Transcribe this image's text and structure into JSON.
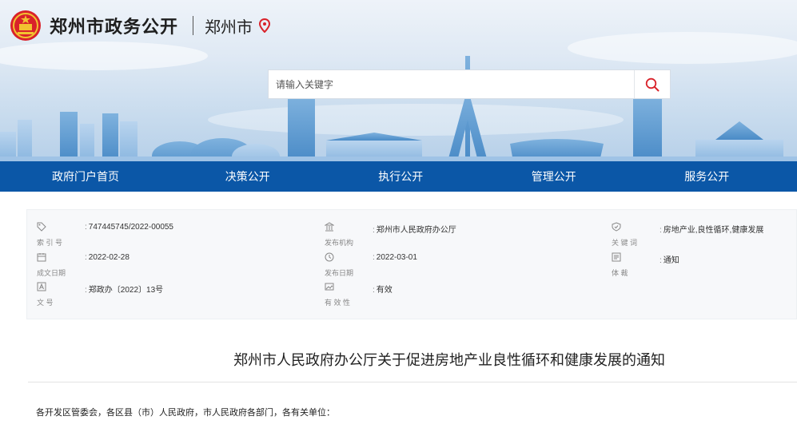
{
  "header": {
    "site_title": "郑州市政务公开",
    "city_name": "郑州市"
  },
  "search": {
    "placeholder": "请输入关键字"
  },
  "nav": {
    "items": [
      "政府门户首页",
      "决策公开",
      "执行公开",
      "管理公开",
      "服务公开"
    ]
  },
  "info": {
    "index_no": {
      "label": "索 引 号",
      "value": "747445745/2022-00055"
    },
    "publisher": {
      "label": "发布机构",
      "value": "郑州市人民政府办公厅"
    },
    "keywords": {
      "label": "关 键 词",
      "value": "房地产业,良性循环,健康发展"
    },
    "created": {
      "label": "成文日期",
      "value": "2022-02-28"
    },
    "published": {
      "label": "发布日期",
      "value": "2022-03-01"
    },
    "genre": {
      "label": "体 裁",
      "value": "通知"
    },
    "doc_no": {
      "label": "文 号",
      "value": "郑政办〔2022〕13号"
    },
    "validity": {
      "label": "有 效 性",
      "value": "有效"
    }
  },
  "article": {
    "title": "郑州市人民政府办公厅关于促进房地产业良性循环和健康发展的通知",
    "salutation": "各开发区管委会，各区县（市）人民政府，市人民政府各部门，各有关单位："
  },
  "colors": {
    "nav_bg": "#0b57a7",
    "accent_red": "#d9222a",
    "skyline": "#5f9bd0"
  },
  "icons": {
    "emblem": "national-emblem-icon",
    "pin": "location-pin-icon",
    "search": "search-icon"
  }
}
